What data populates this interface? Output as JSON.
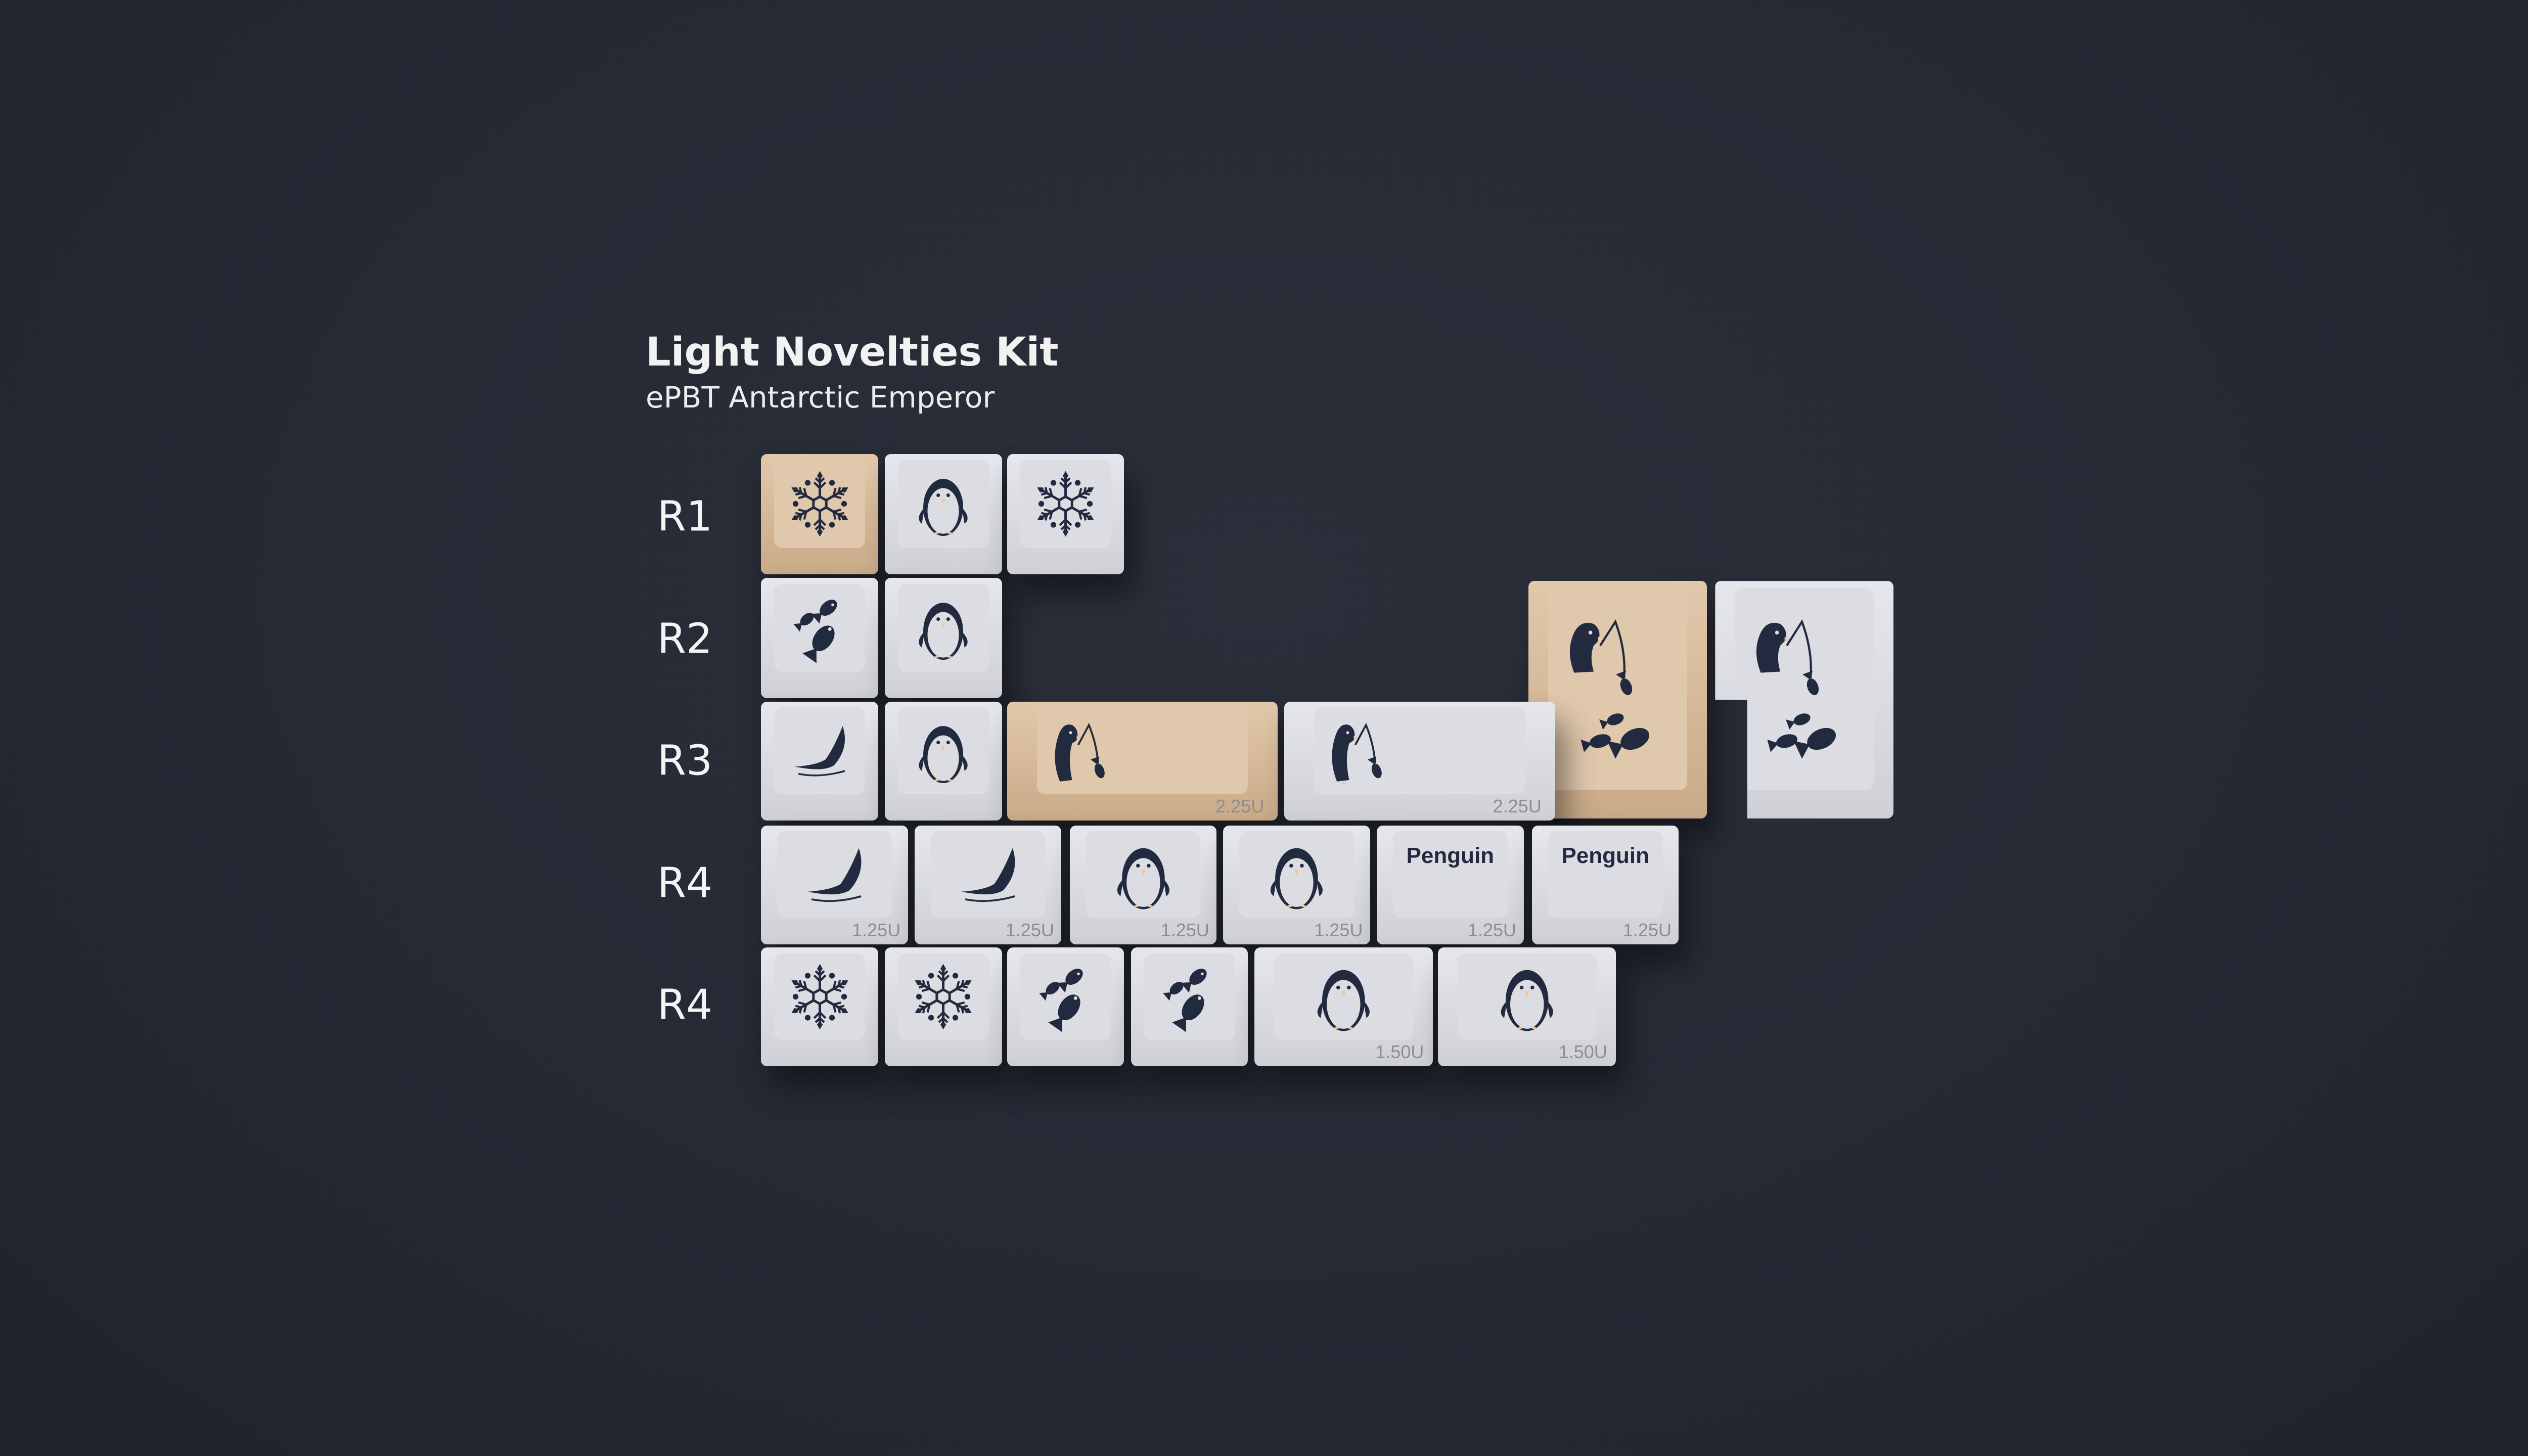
{
  "header": {
    "title": "Light Novelties Kit",
    "subtitle": "ePBT Antarctic Emperor"
  },
  "row_labels": [
    "R1",
    "R2",
    "R3",
    "R4",
    "R4"
  ],
  "colors": {
    "background": "#262a35",
    "legend": "#222a40",
    "white_key": "#dcdde2",
    "tan_key": "#e0c8ad",
    "beak": "#f0c6a0"
  },
  "keys": [
    {
      "row": "R1",
      "color": "tan",
      "legend": "snowflake",
      "size": ""
    },
    {
      "row": "R1",
      "color": "white",
      "legend": "penguin",
      "size": ""
    },
    {
      "row": "R1",
      "color": "white",
      "legend": "snowflake",
      "size": ""
    },
    {
      "row": "R2",
      "color": "white",
      "legend": "fish",
      "size": ""
    },
    {
      "row": "R2",
      "color": "white",
      "legend": "penguin",
      "size": ""
    },
    {
      "row": "R2",
      "color": "tan",
      "legend": "fishing-penguin-tall",
      "size": ""
    },
    {
      "row": "R2",
      "color": "white",
      "legend": "fishing-penguin-tall",
      "size": ""
    },
    {
      "row": "R3",
      "color": "white",
      "legend": "whale-tail",
      "size": ""
    },
    {
      "row": "R3",
      "color": "white",
      "legend": "penguin",
      "size": ""
    },
    {
      "row": "R3",
      "color": "tan",
      "legend": "fishing-penguin",
      "size": "2.25U"
    },
    {
      "row": "R3",
      "color": "white",
      "legend": "fishing-penguin",
      "size": "2.25U"
    },
    {
      "row": "R4",
      "color": "white",
      "legend": "whale-tail",
      "size": "1.25U"
    },
    {
      "row": "R4",
      "color": "white",
      "legend": "whale-tail",
      "size": "1.25U"
    },
    {
      "row": "R4",
      "color": "white",
      "legend": "penguin",
      "size": "1.25U"
    },
    {
      "row": "R4",
      "color": "white",
      "legend": "penguin",
      "size": "1.25U"
    },
    {
      "row": "R4",
      "color": "white",
      "legend": "text",
      "text": "Penguin",
      "size": "1.25U"
    },
    {
      "row": "R4",
      "color": "white",
      "legend": "text",
      "text": "Penguin",
      "size": "1.25U"
    },
    {
      "row": "R4",
      "color": "white",
      "legend": "snowflake",
      "size": ""
    },
    {
      "row": "R4",
      "color": "white",
      "legend": "snowflake",
      "size": ""
    },
    {
      "row": "R4",
      "color": "white",
      "legend": "fish",
      "size": ""
    },
    {
      "row": "R4",
      "color": "white",
      "legend": "fish",
      "size": ""
    },
    {
      "row": "R4",
      "color": "white",
      "legend": "penguin",
      "size": "1.50U"
    },
    {
      "row": "R4",
      "color": "white",
      "legend": "penguin",
      "size": "1.50U"
    }
  ]
}
